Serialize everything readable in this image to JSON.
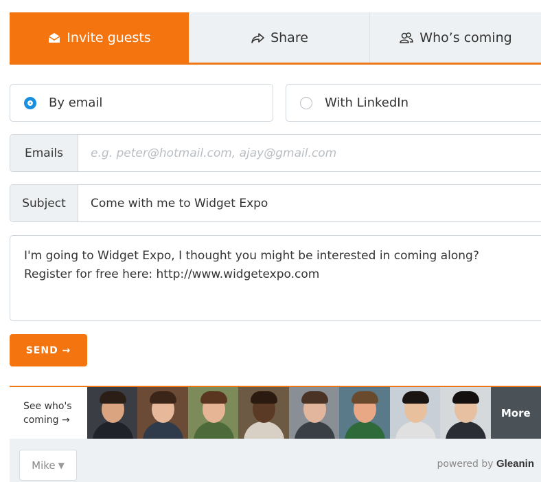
{
  "tabs": [
    {
      "label": "Invite guests",
      "icon": "envelope-icon",
      "active": true
    },
    {
      "label": "Share",
      "icon": "share-arrow-icon",
      "active": false
    },
    {
      "label": "Who’s coming",
      "icon": "people-icon",
      "active": false
    }
  ],
  "invite_methods": {
    "email_label": "By email",
    "email_selected": true,
    "linkedin_label": "With LinkedIn",
    "linkedin_selected": false
  },
  "emails": {
    "label": "Emails",
    "value": "",
    "placeholder": "e.g. peter@hotmail.com, ajay@gmail.com"
  },
  "subject": {
    "label": "Subject",
    "value": "Come with me to Widget Expo"
  },
  "message": {
    "line1": "I'm going to Widget Expo, I thought you might be interested in coming along?",
    "line2": "Register for free here: http://www.widgetexpo.com"
  },
  "send_label": "SEND →",
  "attendees": {
    "see_who_line1": "See who's",
    "see_who_line2": "coming →",
    "more_label": "More",
    "count_shown": 8
  },
  "footer": {
    "user_name": "Mike",
    "powered_prefix": "powered by",
    "brand": "Gleanin"
  },
  "colors": {
    "accent": "#f47510",
    "radio_selected": "#1a8fe0",
    "more_bg": "#4a5258"
  }
}
